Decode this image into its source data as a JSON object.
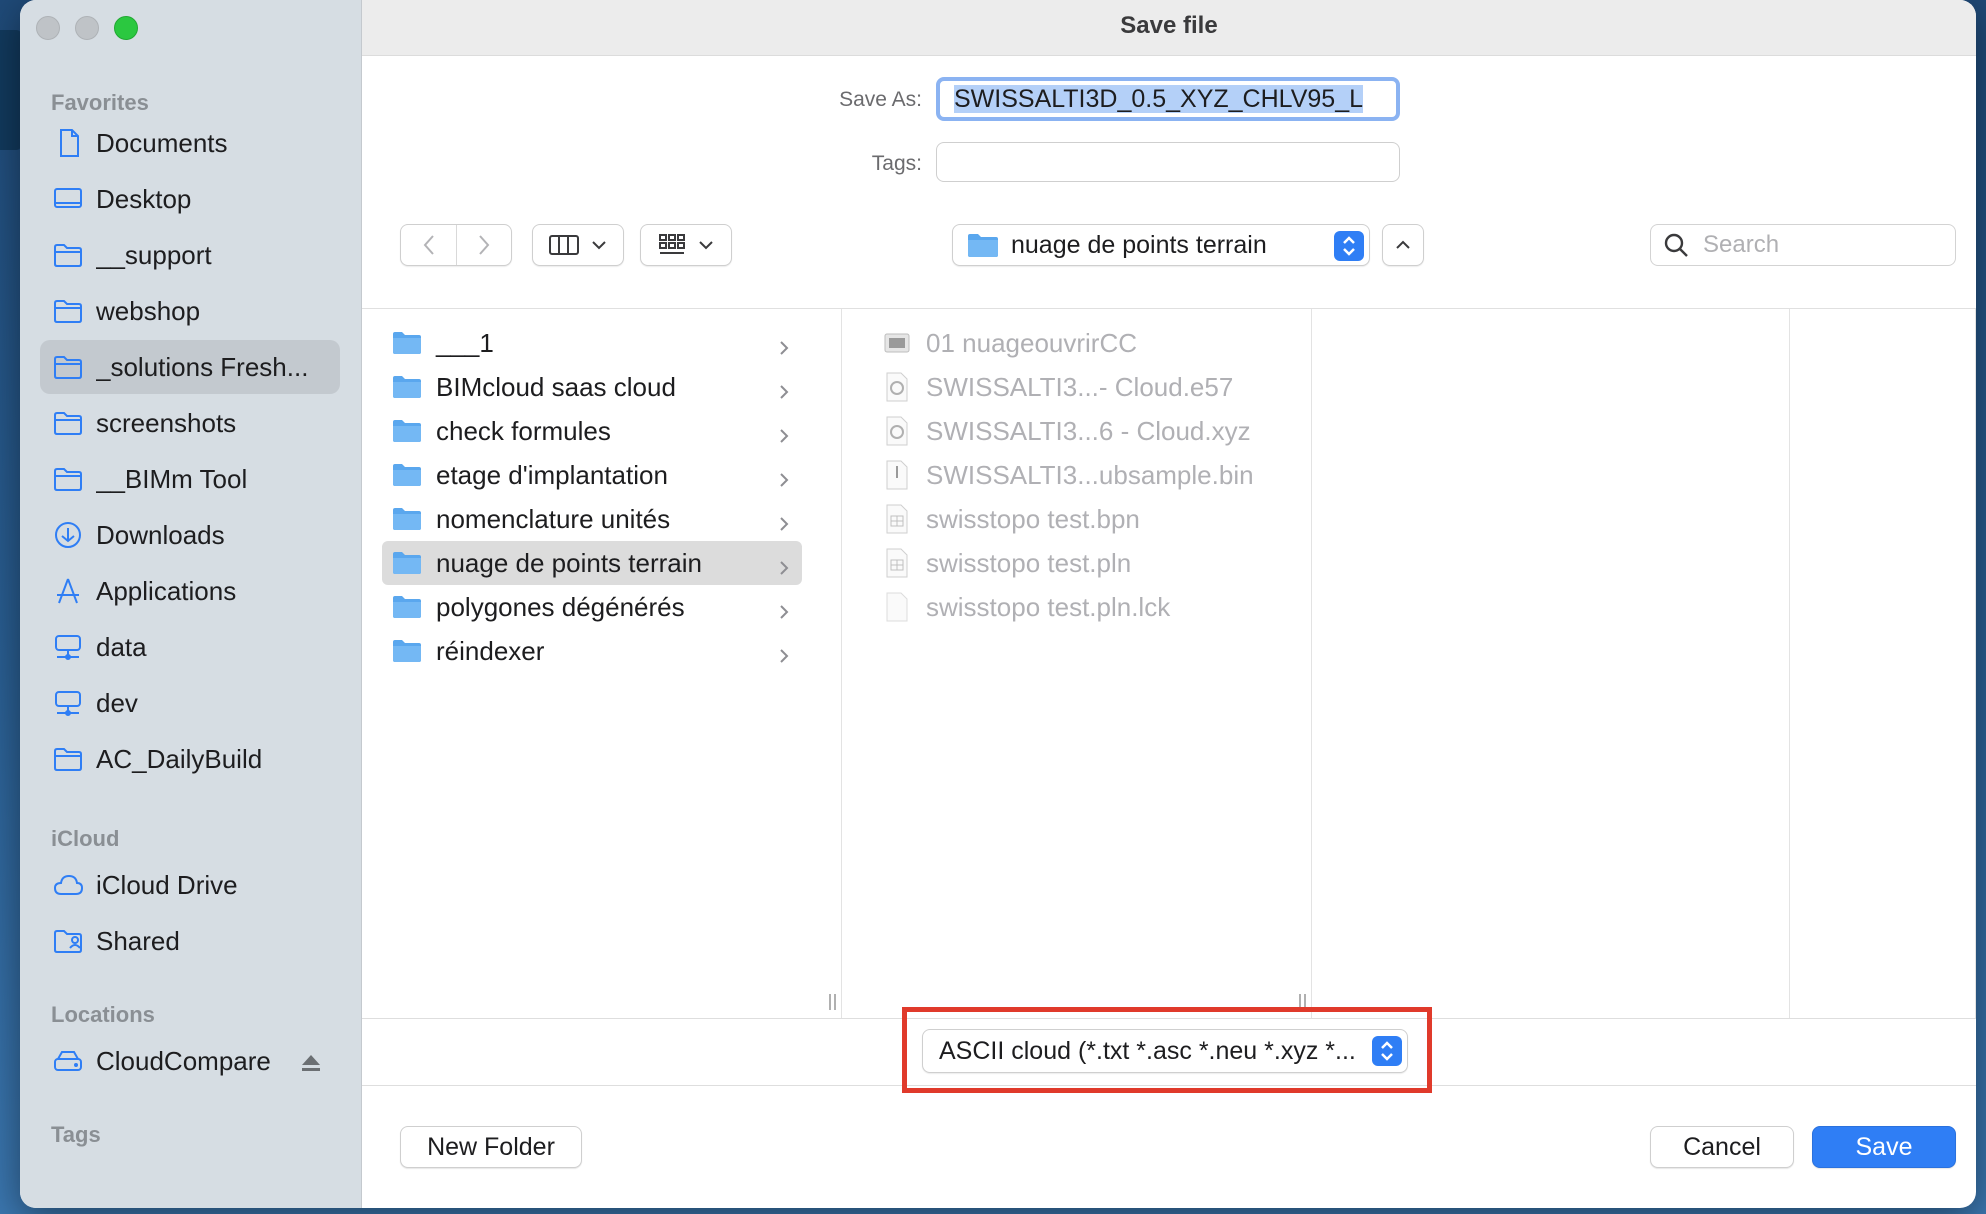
{
  "dialog": {
    "title": "Save file",
    "save_as_label": "Save As:",
    "save_as_value": "SWISSALTI3D_0.5_XYZ_CHLV95_L",
    "tags_label": "Tags:",
    "tags_value": ""
  },
  "sidebar": {
    "sections": [
      {
        "label": "Favorites"
      },
      {
        "label": "iCloud"
      },
      {
        "label": "Locations"
      },
      {
        "label": "Tags"
      }
    ],
    "favorites": [
      {
        "label": "Documents",
        "icon": "document-icon"
      },
      {
        "label": "Desktop",
        "icon": "desktop-icon"
      },
      {
        "label": "__support",
        "icon": "folder-icon"
      },
      {
        "label": "webshop",
        "icon": "folder-icon"
      },
      {
        "label": "_solutions Fresh...",
        "icon": "folder-icon",
        "selected": true
      },
      {
        "label": "screenshots",
        "icon": "folder-icon"
      },
      {
        "label": "__BIMm Tool",
        "icon": "folder-icon"
      },
      {
        "label": "Downloads",
        "icon": "download-icon"
      },
      {
        "label": "Applications",
        "icon": "applications-icon"
      },
      {
        "label": "data",
        "icon": "network-drive-icon"
      },
      {
        "label": "dev",
        "icon": "network-drive-icon"
      },
      {
        "label": "AC_DailyBuild",
        "icon": "folder-icon"
      }
    ],
    "icloud": [
      {
        "label": "iCloud Drive",
        "icon": "cloud-icon"
      },
      {
        "label": "Shared",
        "icon": "shared-folder-icon"
      }
    ],
    "locations": [
      {
        "label": "CloudCompare",
        "icon": "drive-icon",
        "eject": true
      }
    ]
  },
  "toolbar": {
    "current_folder": "nuage de points terrain",
    "search_placeholder": "Search"
  },
  "column1": {
    "folders": [
      {
        "label": "___1"
      },
      {
        "label": "BIMcloud saas cloud"
      },
      {
        "label": "check formules"
      },
      {
        "label": "etage d'implantation"
      },
      {
        "label": "nomenclature unités"
      },
      {
        "label": "nuage de points terrain",
        "selected": true
      },
      {
        "label": "polygones dégénérés"
      },
      {
        "label": "réindexer"
      }
    ]
  },
  "column2": {
    "files": [
      {
        "label": "01 nuageouvrirCC",
        "icon": "image-file-icon"
      },
      {
        "label": "SWISSALTI3...- Cloud.e57",
        "icon": "cloudcompare-file-icon"
      },
      {
        "label": "SWISSALTI3...6 - Cloud.xyz",
        "icon": "cloudcompare-file-icon"
      },
      {
        "label": "SWISSALTI3...ubsample.bin",
        "icon": "binary-file-icon"
      },
      {
        "label": "swisstopo test.bpn",
        "icon": "archicad-file-icon"
      },
      {
        "label": "swisstopo test.pln",
        "icon": "archicad-file-icon"
      },
      {
        "label": "swisstopo test.pln.lck",
        "icon": "blank-file-icon"
      }
    ]
  },
  "format": {
    "selected": "ASCII cloud (*.txt *.asc *.neu *.xyz *...",
    "highlight_color": "#e03a2b"
  },
  "footer": {
    "new_folder": "New Folder",
    "cancel": "Cancel",
    "save": "Save"
  },
  "colors": {
    "accent": "#2f7ef5",
    "sidebar_bg": "#d6dde3",
    "selection": "#dcdcdc"
  }
}
